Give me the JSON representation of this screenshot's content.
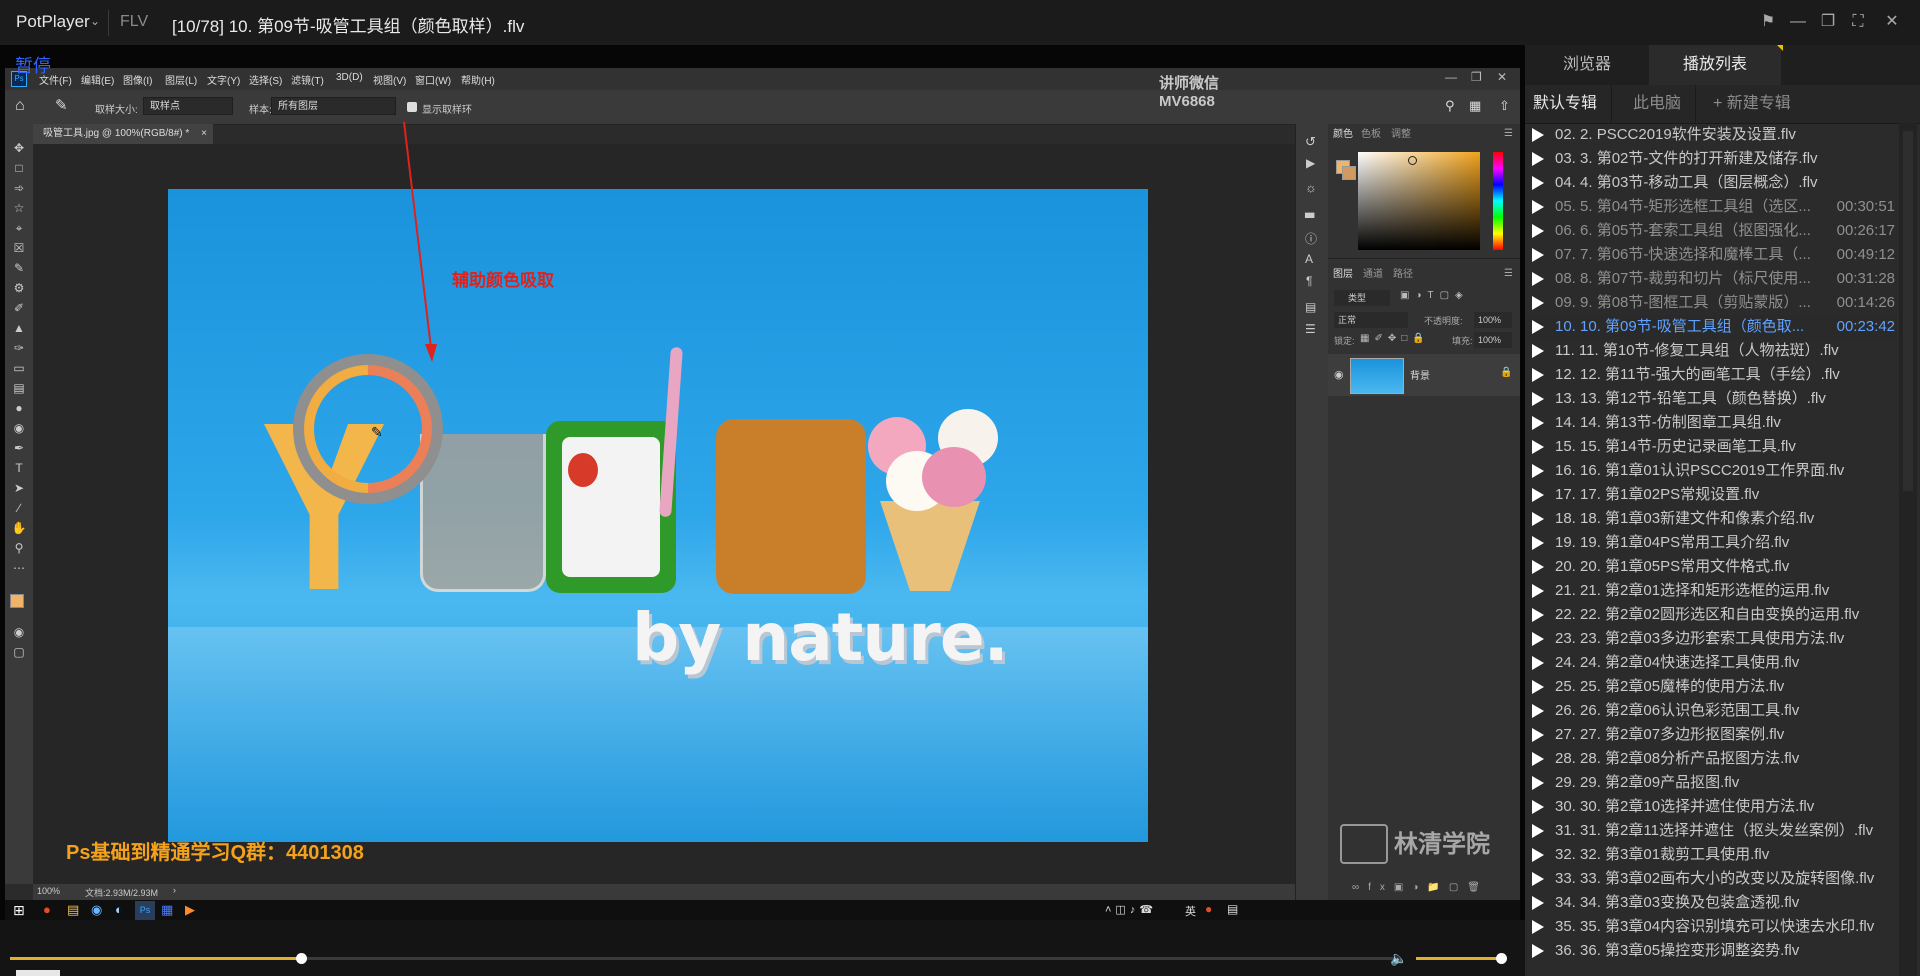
{
  "titlebar": {
    "app_name": "PotPlayer",
    "format": "FLV",
    "title": "[10/78] 10. 第09节-吸管工具组（颜色取样）.flv"
  },
  "video": {
    "status": "暂停",
    "watermark_wechat_line1": "讲师微信",
    "watermark_wechat_line2": "MV6868",
    "annotation": "辅助颜色吸取",
    "qq_group": "Ps基础到精通学习Q群：4401308",
    "brand_watermark": "林清学院",
    "art_text": "by nature."
  },
  "photoshop": {
    "menu": [
      "文件(F)",
      "编辑(E)",
      "图像(I)",
      "图层(L)",
      "文字(Y)",
      "选择(S)",
      "滤镜(T)",
      "3D(D)",
      "视图(V)",
      "窗口(W)",
      "帮助(H)"
    ],
    "options": {
      "sample_size_label": "取样大小:",
      "sample_size_value": "取样点",
      "sample_label": "样本:",
      "sample_value": "所有图层",
      "show_ring_label": "显示取样环"
    },
    "doc_tab": "吸管工具.jpg @ 100%(RGB/8#) *",
    "status_zoom": "100%",
    "status_doc": "文档:2.93M/2.93M",
    "color_tabs": [
      "颜色",
      "色板",
      "调整"
    ],
    "layer_tabs": [
      "图层",
      "通道",
      "路径"
    ],
    "layer_kind": "类型",
    "blend_mode": "正常",
    "opacity_label": "不透明度:",
    "opacity_value": "100%",
    "lock_label": "锁定:",
    "fill_label": "填充:",
    "fill_value": "100%",
    "layer_name": "背景",
    "tray_ime": "英"
  },
  "sidebar": {
    "tabs": [
      "浏览器",
      "播放列表"
    ],
    "albums": [
      "默认专辑",
      "此电脑",
      "+ 新建专辑"
    ],
    "playlist": [
      {
        "title": "02. 2. PSCC2019软件安装及设置.flv",
        "duration": ""
      },
      {
        "title": "03. 3. 第02节-文件的打开新建及储存.flv",
        "duration": ""
      },
      {
        "title": "04. 4. 第03节-移动工具（图层概念）.flv",
        "duration": ""
      },
      {
        "title": "05. 5. 第04节-矩形选框工具组（选区...",
        "duration": "00:30:51"
      },
      {
        "title": "06. 6. 第05节-套索工具组（抠图强化...",
        "duration": "00:26:17"
      },
      {
        "title": "07. 7. 第06节-快速选择和魔棒工具（...",
        "duration": "00:49:12"
      },
      {
        "title": "08. 8. 第07节-裁剪和切片（标尺使用...",
        "duration": "00:31:28"
      },
      {
        "title": "09. 9. 第08节-图框工具（剪贴蒙版）...",
        "duration": "00:14:26"
      },
      {
        "title": "10. 10. 第09节-吸管工具组（颜色取...",
        "duration": "00:23:42"
      },
      {
        "title": "11. 11. 第10节-修复工具组（人物祛斑）.flv",
        "duration": ""
      },
      {
        "title": "12. 12. 第11节-强大的画笔工具（手绘）.flv",
        "duration": ""
      },
      {
        "title": "13. 13. 第12节-铅笔工具（颜色替换）.flv",
        "duration": ""
      },
      {
        "title": "14. 14. 第13节-仿制图章工具组.flv",
        "duration": ""
      },
      {
        "title": "15. 15. 第14节-历史记录画笔工具.flv",
        "duration": ""
      },
      {
        "title": "16. 16. 第1章01认识PSCC2019工作界面.flv",
        "duration": ""
      },
      {
        "title": "17. 17. 第1章02PS常规设置.flv",
        "duration": ""
      },
      {
        "title": "18. 18. 第1章03新建文件和像素介绍.flv",
        "duration": ""
      },
      {
        "title": "19. 19. 第1章04PS常用工具介绍.flv",
        "duration": ""
      },
      {
        "title": "20. 20. 第1章05PS常用文件格式.flv",
        "duration": ""
      },
      {
        "title": "21. 21. 第2章01选择和矩形选框的运用.flv",
        "duration": ""
      },
      {
        "title": "22. 22. 第2章02圆形选区和自由变换的运用.flv",
        "duration": ""
      },
      {
        "title": "23. 23. 第2章03多边形套索工具使用方法.flv",
        "duration": ""
      },
      {
        "title": "24. 24. 第2章04快速选择工具使用.flv",
        "duration": ""
      },
      {
        "title": "25. 25. 第2章05魔棒的使用方法.flv",
        "duration": ""
      },
      {
        "title": "26. 26. 第2章06认识色彩范围工具.flv",
        "duration": ""
      },
      {
        "title": "27. 27. 第2章07多边形抠图案例.flv",
        "duration": ""
      },
      {
        "title": "28. 28. 第2章08分析产品抠图方法.flv",
        "duration": ""
      },
      {
        "title": "29. 29. 第2章09产品抠图.flv",
        "duration": ""
      },
      {
        "title": "30. 30. 第2章10选择并遮住使用方法.flv",
        "duration": ""
      },
      {
        "title": "31. 31. 第2章11选择并遮住（抠头发丝案例）.flv",
        "duration": ""
      },
      {
        "title": "32. 32. 第3章01裁剪工具使用.flv",
        "duration": ""
      },
      {
        "title": "33. 33. 第3章02画布大小的改变以及旋转图像.flv",
        "duration": ""
      },
      {
        "title": "34. 34. 第3章03变换及包装盒透视.flv",
        "duration": ""
      },
      {
        "title": "35. 35. 第3章04内容识别填充可以快速去水印.flv",
        "duration": ""
      },
      {
        "title": "36. 36. 第3章05操控变形调整姿势.flv",
        "duration": ""
      }
    ]
  },
  "controls": {
    "seek_progress": 0.21,
    "volume_level": 1.0
  },
  "colors": {
    "accent_blue": "#5fa3ff",
    "annotation_red": "#e0221c",
    "seek_yellow": "#e1b12c",
    "qq_text": "#f4a21b"
  }
}
